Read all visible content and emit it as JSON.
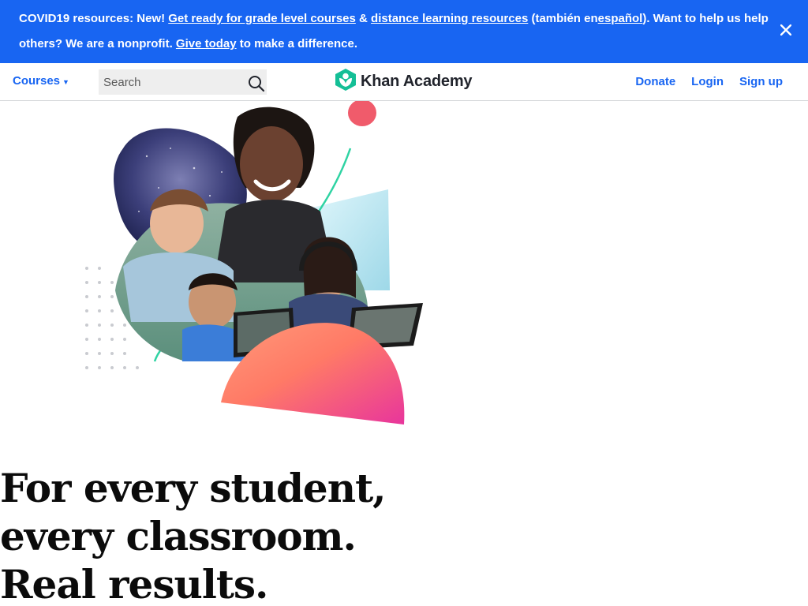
{
  "banner": {
    "prefix": "COVID19 resources: New!",
    "link_grade_level": "Get ready for grade level courses",
    "ampersand": "&",
    "link_distance_learning": "distance learning resources",
    "tambien_prefix": "(también en",
    "link_espanol": "español",
    "tambien_suffix": "). Want to help us help others? We are a nonprofit.",
    "link_give_today": "Give today",
    "suffix": "to make a difference.",
    "close_icon": "close-icon"
  },
  "nav": {
    "courses_label": "Courses",
    "search_placeholder": "Search",
    "logo_text": "Khan Academy",
    "donate_label": "Donate",
    "login_label": "Login",
    "signup_label": "Sign up"
  },
  "hero": {
    "headline_line1": "For every student,",
    "headline_line2": "every classroom.",
    "headline_line3": "Real results."
  },
  "colors": {
    "brand_blue": "#1865f2",
    "logo_green": "#14bf96",
    "text_dark": "#21242c"
  }
}
